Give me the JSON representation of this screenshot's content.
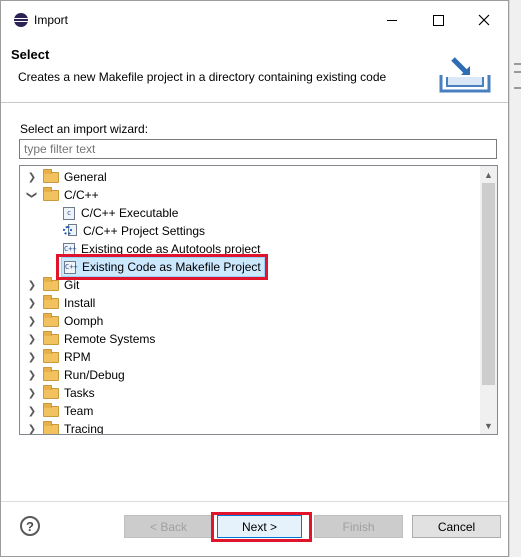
{
  "window": {
    "title": "Import"
  },
  "header": {
    "title": "Select",
    "description": "Creates a new Makefile project in a directory containing existing code"
  },
  "wizard": {
    "label": "Select an import wizard:",
    "filter_placeholder": "type filter text"
  },
  "tree": {
    "items": [
      {
        "label": "General",
        "type": "folder",
        "expanded": false,
        "icon": "folder-icon"
      },
      {
        "label": "C/C++",
        "type": "folder",
        "expanded": true,
        "icon": "folder-icon"
      },
      {
        "label": "C/C++ Executable",
        "type": "item",
        "icon": "c-file-icon"
      },
      {
        "label": "C/C++ Project Settings",
        "type": "item",
        "icon": "settings-file-icon"
      },
      {
        "label": "Existing code as Autotools project",
        "type": "item",
        "icon": "c-file-icon"
      },
      {
        "label": "Existing Code as Makefile Project",
        "type": "item",
        "icon": "c-file-icon",
        "selected": true
      },
      {
        "label": "Git",
        "type": "folder",
        "expanded": false,
        "icon": "folder-icon"
      },
      {
        "label": "Install",
        "type": "folder",
        "expanded": false,
        "icon": "folder-icon"
      },
      {
        "label": "Oomph",
        "type": "folder",
        "expanded": false,
        "icon": "folder-icon"
      },
      {
        "label": "Remote Systems",
        "type": "folder",
        "expanded": false,
        "icon": "folder-icon"
      },
      {
        "label": "RPM",
        "type": "folder",
        "expanded": false,
        "icon": "folder-icon"
      },
      {
        "label": "Run/Debug",
        "type": "folder",
        "expanded": false,
        "icon": "folder-icon"
      },
      {
        "label": "Tasks",
        "type": "folder",
        "expanded": false,
        "icon": "folder-icon"
      },
      {
        "label": "Team",
        "type": "folder",
        "expanded": false,
        "icon": "folder-icon"
      },
      {
        "label": "Tracing",
        "type": "folder",
        "expanded": false,
        "icon": "folder-icon"
      }
    ]
  },
  "buttons": {
    "back": "< Back",
    "next": "Next >",
    "finish": "Finish",
    "cancel": "Cancel",
    "help": "?"
  },
  "icon_glyphs": {
    "c_file": "c",
    "cpp_file": "C++"
  },
  "colors": {
    "highlight": "#e0142b",
    "selection": "#cce8ff",
    "focus": "#0078d7"
  }
}
